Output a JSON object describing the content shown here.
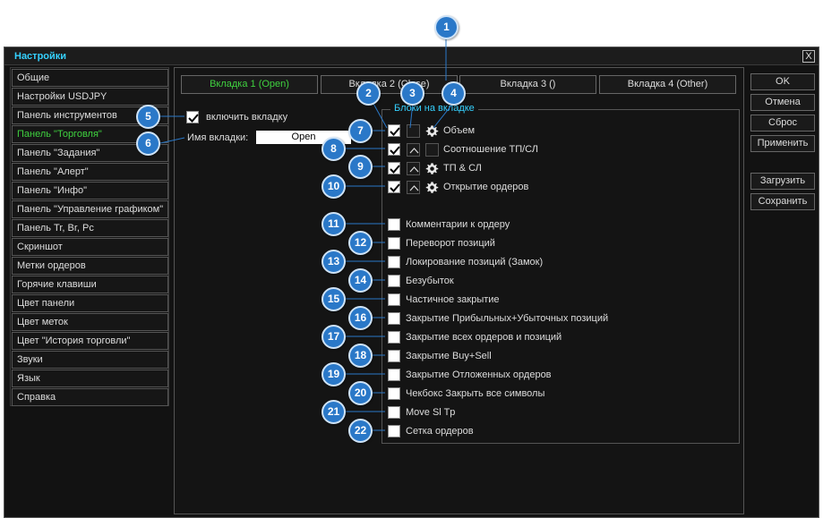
{
  "window": {
    "title": "Настройки",
    "close": "X"
  },
  "menu": [
    "Общие",
    "Настройки USDJPY",
    "Панель инструментов",
    "Панель \"Торговля\"",
    "Панель \"Задания\"",
    "Панель \"Алерт\"",
    "Панель \"Инфо\"",
    "Панель \"Управление графиком\"",
    "Панель Tr, Br, Pc",
    "Скриншот",
    "Метки ордеров",
    "Горячие клавиши",
    "Цвет панели",
    "Цвет меток",
    "Цвет \"История торговли\"",
    "Звуки",
    "Язык",
    "Справка"
  ],
  "active_menu_index": 3,
  "tabs": [
    "Вкладка 1 (Open)",
    "Вкладка 2 (Close)",
    "Вкладка 3 ()",
    "Вкладка 4 (Other)"
  ],
  "enable_tab": {
    "label": "включить вкладку",
    "checked": true
  },
  "tab_name": {
    "label": "Имя вкладки:",
    "value": "Open"
  },
  "blocks": {
    "title": "Блоки на вкладке",
    "items": [
      "Объем",
      "Соотношение ТП/СЛ",
      "ТП & СЛ",
      "Открытие ордеров",
      "Комментарии к ордеру",
      "Переворот позиций",
      "Локирование позиций (Замок)",
      "Безубыток",
      "Частичное закрытие",
      "Закрытие Прибыльных+Убыточных позиций",
      "Закрытие всех ордеров и позиций",
      "Закрытие Buy+Sell",
      "Закрытие Отложенных ордеров",
      "Чекбокс Закрыть все символы",
      "Move Sl Tp",
      "Сетка ордеров"
    ]
  },
  "buttons": [
    "OK",
    "Отмена",
    "Сброс",
    "Применить",
    "Загрузить",
    "Сохранить"
  ],
  "callouts": [
    "1",
    "2",
    "3",
    "4",
    "5",
    "6",
    "7",
    "8",
    "9",
    "10",
    "11",
    "12",
    "13",
    "14",
    "15",
    "16",
    "17",
    "18",
    "19",
    "20",
    "21",
    "22"
  ],
  "colors": {
    "accent": "#35d1ff",
    "active_green": "#3fd13f",
    "callout": "#2a78c8"
  }
}
